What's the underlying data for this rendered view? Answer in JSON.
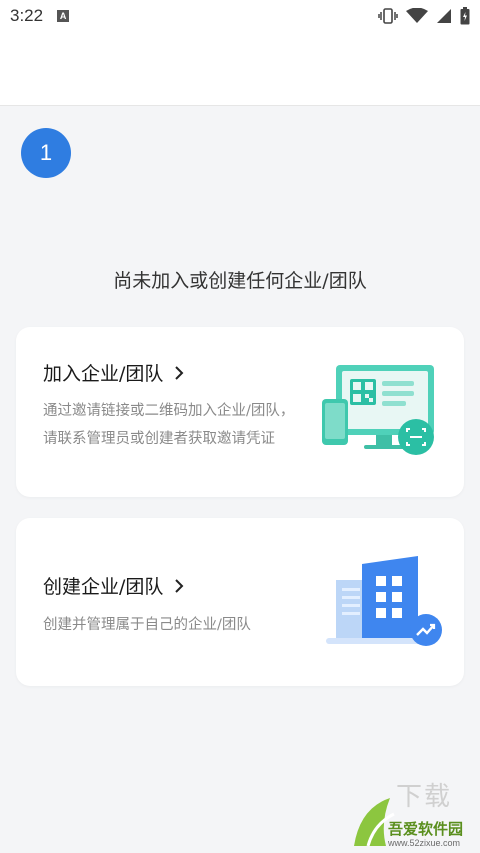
{
  "status_bar": {
    "time": "3:22",
    "app_icon_letter": "A",
    "icons": [
      "vibrate-icon",
      "wifi-icon",
      "signal-icon",
      "battery-icon"
    ]
  },
  "step": {
    "number": "1"
  },
  "empty_state": {
    "title": "尚未加入或创建任何企业/团队"
  },
  "cards": {
    "join": {
      "title": "加入企业/团队",
      "description": "通过邀请链接或二维码加入企业/团队，请联系管理员或创建者获取邀请凭证",
      "icon": "qr-scan-illustration"
    },
    "create": {
      "title": "创建企业/团队",
      "description": "创建并管理属于自己的企业/团队",
      "icon": "building-illustration"
    }
  },
  "watermark": {
    "brand": "吾爱软件园",
    "url": "www.52zixue.com",
    "overlay": "下载"
  },
  "colors": {
    "accent": "#2f7de1",
    "teal": "#2bbfa4",
    "background": "#f4f5f7"
  }
}
